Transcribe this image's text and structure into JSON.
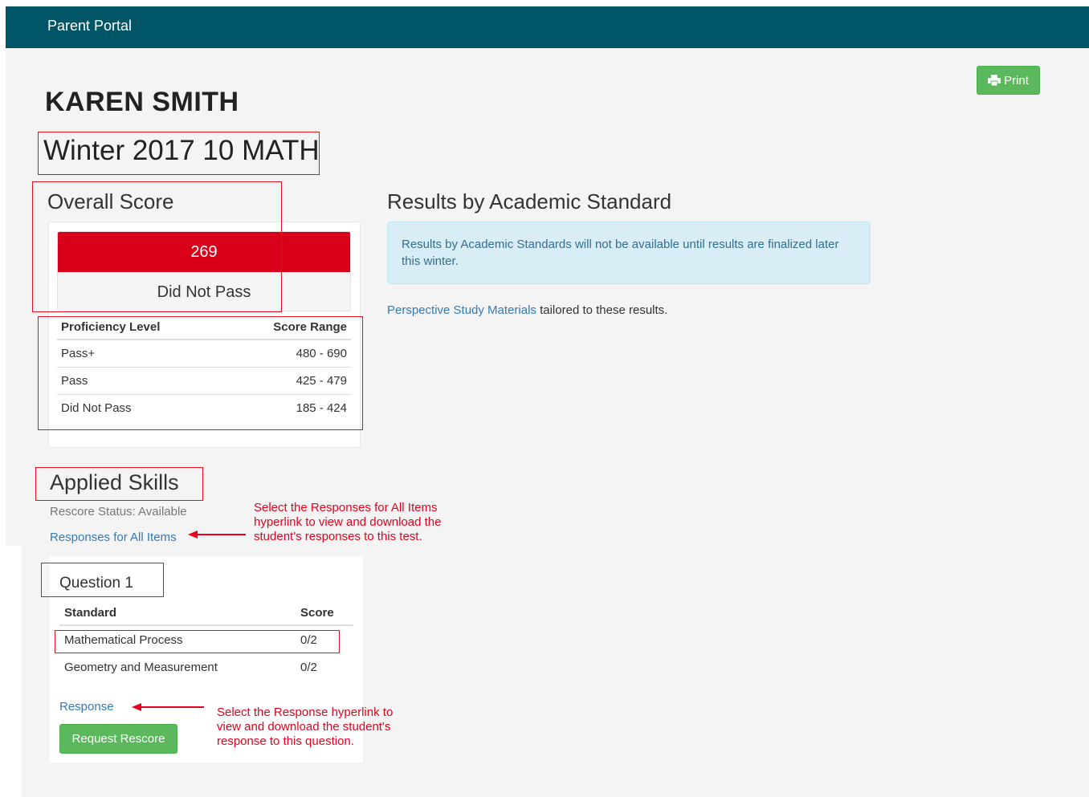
{
  "app": {
    "brand": "Parent Portal"
  },
  "toolbar": {
    "print_label": "Print"
  },
  "student": {
    "name": "KAREN SMITH"
  },
  "test": {
    "title": "Winter 2017 10 MATH"
  },
  "overall": {
    "heading": "Overall Score",
    "score": "269",
    "status": "Did Not Pass",
    "score_color": "#d9001b",
    "table": {
      "headers": [
        "Proficiency Level",
        "Score Range"
      ],
      "rows": [
        [
          "Pass+",
          "480 - 690"
        ],
        [
          "Pass",
          "425 - 479"
        ],
        [
          "Did Not Pass",
          "185 - 424"
        ]
      ]
    }
  },
  "results": {
    "heading": "Results by Academic Standard",
    "notice": "Results by Academic Standards will not be available until results are finalized later this winter.",
    "study_link": "Perspective Study Materials",
    "study_suffix": " tailored to these results."
  },
  "applied": {
    "heading": "Applied Skills",
    "rescore_status": "Rescore Status: Available",
    "responses_link": "Responses for All Items",
    "question": {
      "title": "Question 1",
      "headers": [
        "Standard",
        "Score"
      ],
      "rows": [
        [
          "Mathematical Process",
          "0/2"
        ],
        [
          "Geometry and Measurement",
          "0/2"
        ]
      ],
      "response_link": "Response",
      "rescore_button": "Request Rescore"
    }
  },
  "annotations": {
    "callout_responses": "Select the Responses for All Items hyperlink to view and download the student's responses to this test.",
    "callout_response": "Select the Response hyperlink to view and download the student's response to this question."
  },
  "colors": {
    "navbar": "#005566",
    "success": "#5cb85c",
    "link": "#337ab7",
    "annotation": "#e8001c",
    "info_bg": "#d9edf7",
    "info_text": "#31708f"
  }
}
